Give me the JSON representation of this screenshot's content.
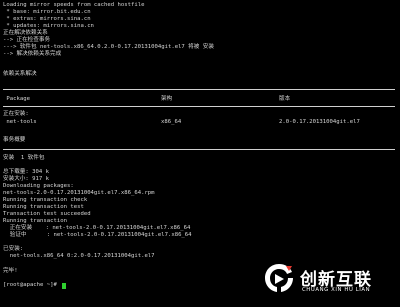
{
  "terminal": {
    "lines": [
      "Loading mirror speeds from cached hostfile",
      " * base: mirror.bit.edu.cn",
      " * extras: mirrors.sina.cn",
      " * updates: mirrors.sina.cn",
      "正在解决依赖关系",
      "--> 正在检查事务",
      "---> 软件包 net-tools.x86_64.0.2.0-0.17.20131004git.el7 将被 安装",
      "--> 解决依赖关系完成",
      "",
      "依赖关系解决",
      "",
      "",
      " Package",
      "",
      "正在安装:",
      " net-tools",
      "",
      "事务概要",
      "",
      "安装  1 软件包",
      "",
      "总下载量: 304 k",
      "安装大小: 917 k",
      "Downloading packages:",
      "net-tools-2.0-0.17.20131004git.el7.x86_64.rpm",
      "Running transaction check",
      "Running transaction test",
      "Transaction test succeeded",
      "Running transaction",
      "  正在安装    : net-tools-2.0-0.17.20131004git.el7.x86_64",
      "  验证中      : net-tools-2.0-0.17.20131004git.el7.x86_64",
      "",
      "已安装:",
      "  net-tools.x86_64 0:2.0-0.17.20131004git.el7",
      "",
      "完毕!",
      "[root@apache ~]# "
    ],
    "table_header": {
      "arch": "架构",
      "version": "版本"
    },
    "table_row": {
      "arch": "x86_64",
      "version": "2.0-0.17.20131004git.el7"
    }
  },
  "watermark": {
    "title": "创新互联",
    "subtitle": "CHUANG XIN HU LIAN"
  }
}
